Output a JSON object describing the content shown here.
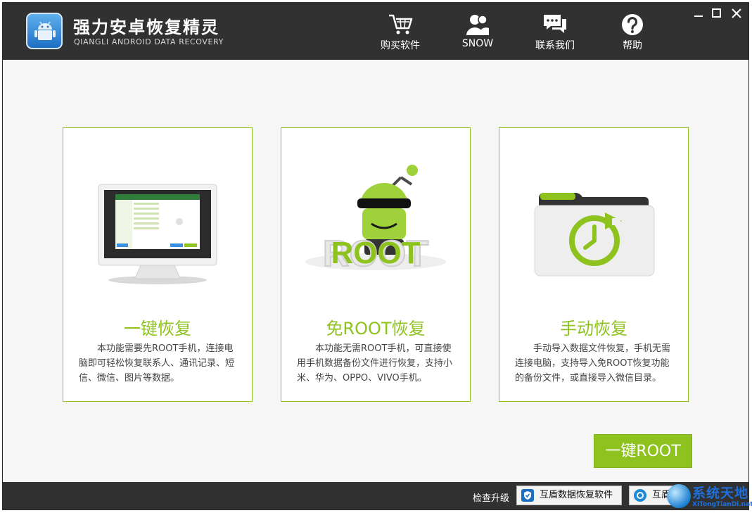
{
  "app": {
    "title": "强力安卓恢复精灵",
    "subtitle": "QIANGLI ANDROID DATA RECOVERY"
  },
  "nav": {
    "buy": "购买软件",
    "user": "SNOW",
    "contact": "联系我们",
    "help": "帮助"
  },
  "cards": [
    {
      "title": "一键恢复",
      "desc": "本功能需要先ROOT手机，连接电脑即可轻松恢复联系人、通讯记录、短信、微信、图片等数据。",
      "icon": "monitor-icon"
    },
    {
      "title": "免ROOT恢复",
      "desc": "本功能无需ROOT手机，可直接使用手机数据备份文件进行恢复，支持小米、华为、OPPO、VIVO手机。",
      "icon": "android-root-icon",
      "badge": "ROOT"
    },
    {
      "title": "手动恢复",
      "desc": "手动导入数据文件恢复，手机无需连接电脑，支持导入免ROOT恢复功能的备份文件，或直接导入微信目录。",
      "icon": "folder-restore-icon"
    }
  ],
  "root_button": "一键ROOT",
  "statusbar": {
    "check_update": "检查升级",
    "btn1": "互盾数据恢复软件",
    "btn2": "互盾"
  },
  "watermark": {
    "text": "系统天地",
    "sub": "XiTongTianDi.net"
  },
  "colors": {
    "accent": "#8dc21f",
    "titlebar": "#313131",
    "background": "#f7f6f6"
  }
}
